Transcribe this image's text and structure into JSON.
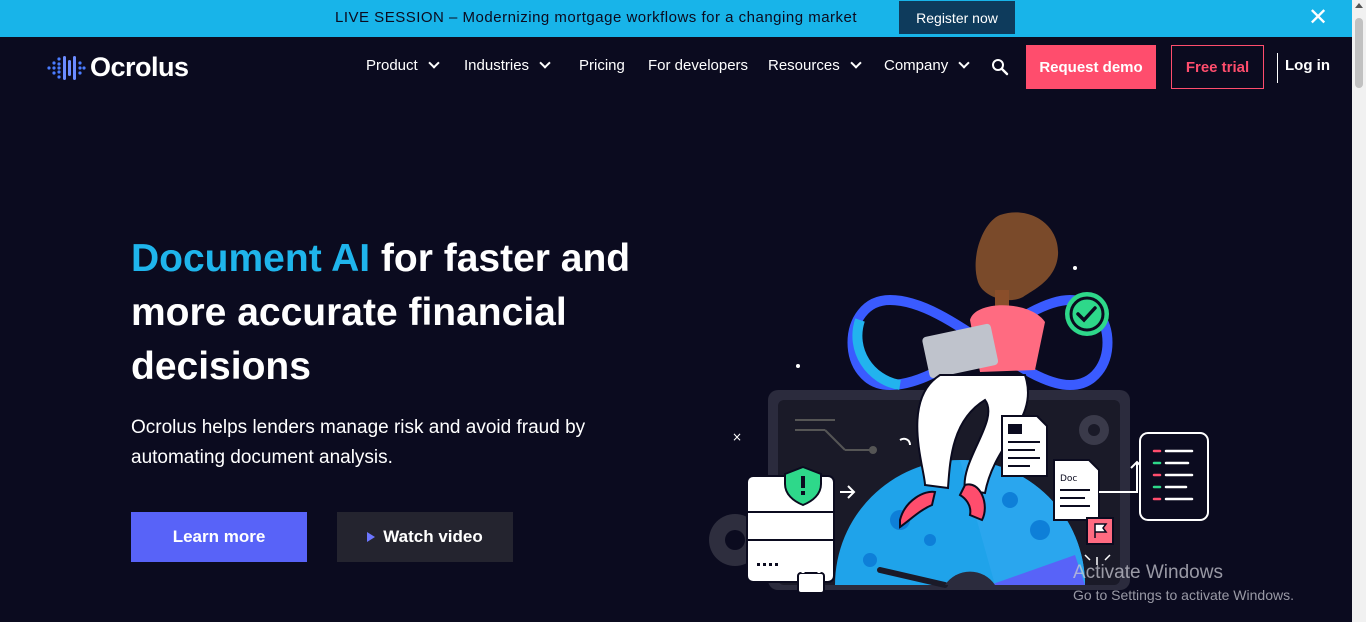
{
  "banner": {
    "text": "LIVE SESSION – Modernizing mortgage workflows for a changing market",
    "cta": "Register now",
    "close": "✕"
  },
  "nav": {
    "logo_text": "Ocrolus",
    "items": [
      {
        "label": "Product",
        "dropdown": true
      },
      {
        "label": "Industries",
        "dropdown": true
      },
      {
        "label": "Pricing",
        "dropdown": false
      },
      {
        "label": "For developers",
        "dropdown": false
      },
      {
        "label": "Resources",
        "dropdown": true
      },
      {
        "label": "Company",
        "dropdown": true
      }
    ],
    "search_icon": "search-icon",
    "request_demo": "Request demo",
    "free_trial": "Free trial",
    "login": "Log in"
  },
  "hero": {
    "title_accent": "Document AI",
    "title_rest": " for faster and more accurate financial decisions",
    "subtitle": "Ocrolus helps lenders manage risk and avoid fraud by automating document analysis.",
    "learn_more": "Learn more",
    "watch_video": "Watch video"
  },
  "illustration": {
    "doc_label": "Doc"
  },
  "watermark": {
    "title": "Activate Windows",
    "subtitle": "Go to Settings to activate Windows."
  },
  "colors": {
    "background": "#0b0b1f",
    "banner": "#18b4e9",
    "accent_blue": "#1fb5ec",
    "cta_pink": "#ff4d6d",
    "primary_purple": "#5863f8"
  }
}
